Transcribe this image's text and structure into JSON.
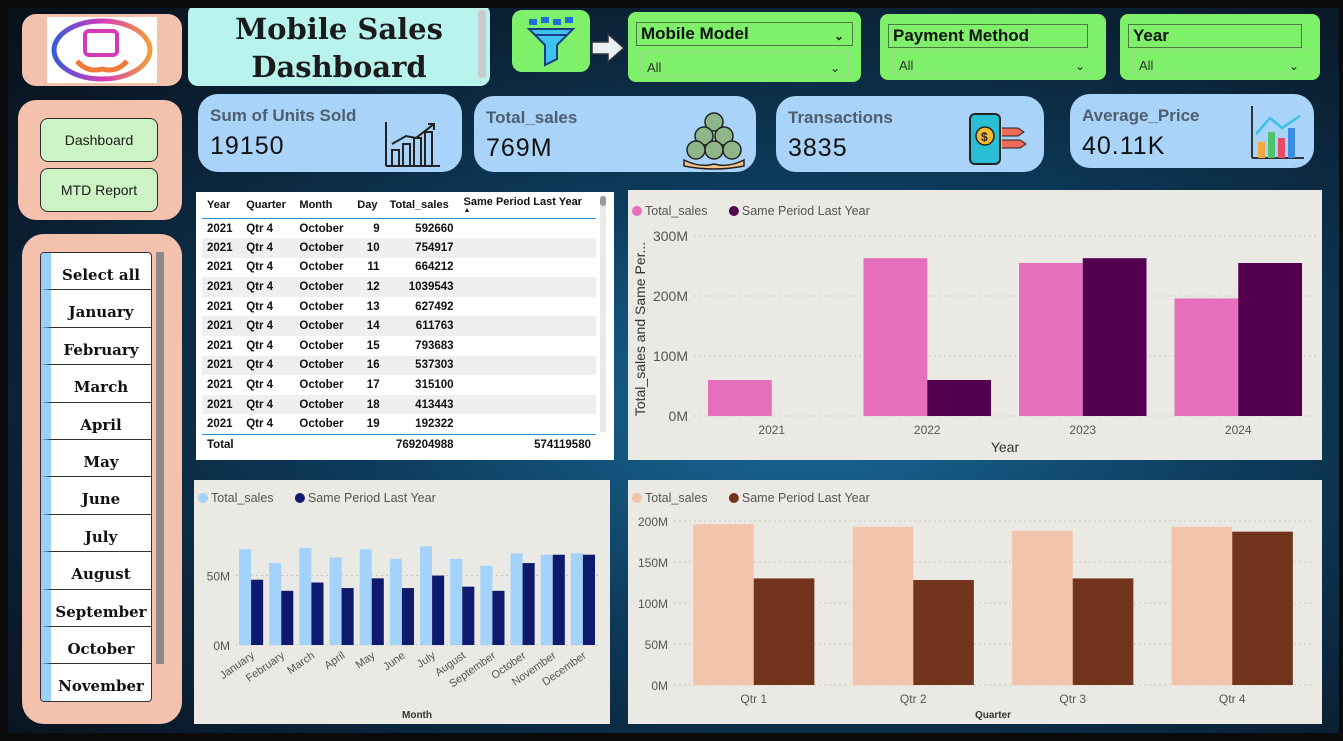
{
  "header": {
    "title_line1": "Mobile Sales",
    "title_line2": "Dashboard"
  },
  "filters": [
    {
      "title": "Mobile Model",
      "value": "All"
    },
    {
      "title": "Payment Method",
      "value": "All"
    },
    {
      "title": "Year",
      "value": "All"
    }
  ],
  "nav": {
    "dashboard_label": "Dashboard",
    "mtd_label": "MTD Report"
  },
  "months": [
    "Select all",
    "January",
    "February",
    "March",
    "April",
    "May",
    "June",
    "July",
    "August",
    "September",
    "October",
    "November"
  ],
  "kpis": [
    {
      "label": "Sum of Units Sold",
      "value": "19150",
      "icon": "bar-growth-icon"
    },
    {
      "label": "Total_sales",
      "value": "769M",
      "icon": "money-bags-icon"
    },
    {
      "label": "Transactions",
      "value": "3835",
      "icon": "mobile-payment-icon"
    },
    {
      "label": "Average_Price",
      "value": "40.11K",
      "icon": "chart-analytics-icon"
    }
  ],
  "table": {
    "columns": [
      "Year",
      "Quarter",
      "Month",
      "Day",
      "Total_sales",
      "Same Period Last Year"
    ],
    "rows": [
      [
        "2021",
        "Qtr 4",
        "October",
        "9",
        "592660",
        ""
      ],
      [
        "2021",
        "Qtr 4",
        "October",
        "10",
        "754917",
        ""
      ],
      [
        "2021",
        "Qtr 4",
        "October",
        "11",
        "664212",
        ""
      ],
      [
        "2021",
        "Qtr 4",
        "October",
        "12",
        "1039543",
        ""
      ],
      [
        "2021",
        "Qtr 4",
        "October",
        "13",
        "627492",
        ""
      ],
      [
        "2021",
        "Qtr 4",
        "October",
        "14",
        "611763",
        ""
      ],
      [
        "2021",
        "Qtr 4",
        "October",
        "15",
        "793683",
        ""
      ],
      [
        "2021",
        "Qtr 4",
        "October",
        "16",
        "537303",
        ""
      ],
      [
        "2021",
        "Qtr 4",
        "October",
        "17",
        "315100",
        ""
      ],
      [
        "2021",
        "Qtr 4",
        "October",
        "18",
        "413443",
        ""
      ],
      [
        "2021",
        "Qtr 4",
        "October",
        "19",
        "192322",
        ""
      ]
    ],
    "total": {
      "label": "Total",
      "total_sales": "769204988",
      "same_period": "574119580"
    }
  },
  "colors": {
    "year_ts": "#e56ebd",
    "year_sply": "#52004f",
    "month_ts": "#a3d2fa",
    "month_sply": "#0f1a6e",
    "qtr_ts": "#f3c4ac",
    "qtr_sply": "#73341d"
  },
  "chart_data": [
    {
      "type": "bar",
      "title": "",
      "categories": [
        "2021",
        "2022",
        "2023",
        "2024"
      ],
      "series": [
        {
          "name": "Total_sales",
          "values": [
            60,
            263,
            255,
            196
          ]
        },
        {
          "name": "Same Period Last Year",
          "values": [
            0,
            60,
            263,
            255
          ]
        }
      ],
      "xlabel": "Year",
      "ylabel": "Total_sales and Same Per...",
      "yticks": [
        "0M",
        "100M",
        "200M",
        "300M"
      ],
      "ylim": [
        0,
        310
      ],
      "units": "M",
      "grid": true,
      "legend": "top-left"
    },
    {
      "type": "bar",
      "title": "",
      "categories": [
        "January",
        "February",
        "March",
        "April",
        "May",
        "June",
        "July",
        "August",
        "September",
        "October",
        "November",
        "December"
      ],
      "series": [
        {
          "name": "Total_sales",
          "values": [
            69,
            59,
            70,
            63,
            69,
            62,
            71,
            62,
            57,
            66,
            65,
            66
          ]
        },
        {
          "name": "Same Period Last Year",
          "values": [
            47,
            39,
            45,
            41,
            48,
            41,
            50,
            42,
            39,
            59,
            65,
            65
          ]
        }
      ],
      "xlabel": "Month",
      "ylabel": "",
      "yticks": [
        "0M",
        "50M"
      ],
      "ylim": [
        0,
        90
      ],
      "units": "M",
      "grid": true,
      "legend": "top-left"
    },
    {
      "type": "bar",
      "title": "",
      "categories": [
        "Qtr 1",
        "Qtr 2",
        "Qtr 3",
        "Qtr 4"
      ],
      "series": [
        {
          "name": "Total_sales",
          "values": [
            196,
            193,
            188,
            193
          ]
        },
        {
          "name": "Same Period Last Year",
          "values": [
            130,
            128,
            130,
            187
          ]
        }
      ],
      "xlabel": "Quarter",
      "ylabel": "",
      "yticks": [
        "0M",
        "50M",
        "100M",
        "150M",
        "200M"
      ],
      "ylim": [
        0,
        200
      ],
      "units": "M",
      "grid": true,
      "legend": "top-left"
    }
  ]
}
